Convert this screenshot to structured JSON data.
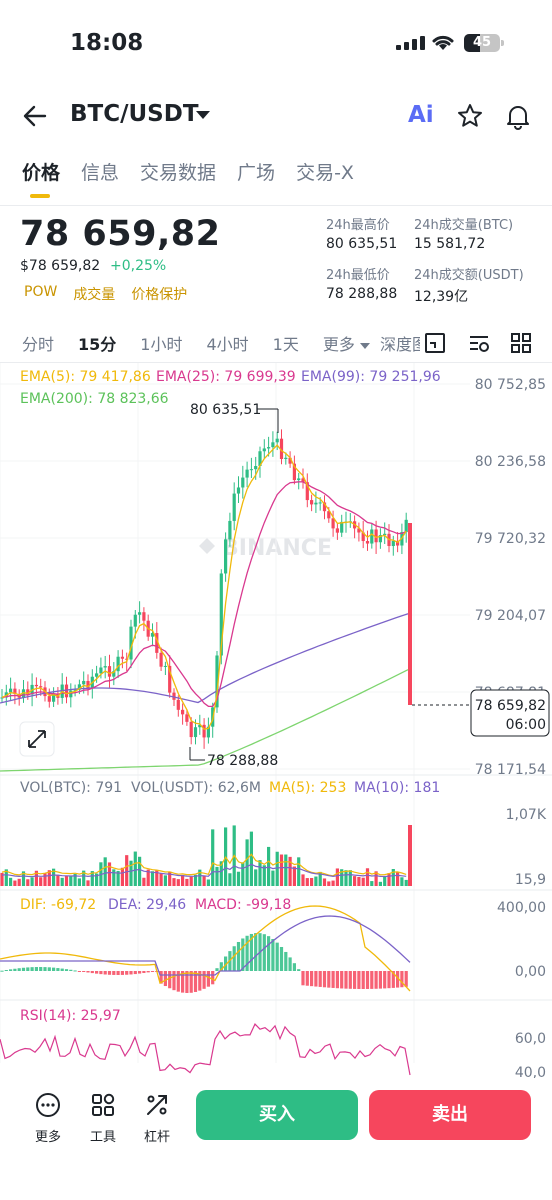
{
  "status_bar": {
    "time": "18:08",
    "battery": "45"
  },
  "header": {
    "pair": "BTC/USDT",
    "ai_label": "Ai"
  },
  "tabs": [
    {
      "label": "价格",
      "active": true
    },
    {
      "label": "信息"
    },
    {
      "label": "交易数据"
    },
    {
      "label": "广场"
    },
    {
      "label": "交易-X"
    }
  ],
  "price": {
    "last": "78 659,82",
    "usd": "$78 659,82",
    "change": "+0,25%",
    "tags": [
      "POW",
      "成交量",
      "价格保护"
    ]
  },
  "stats": {
    "high_label": "24h最高价",
    "high": "80 635,51",
    "vol_btc_label": "24h成交量(BTC)",
    "vol_btc": "15 581,72",
    "low_label": "24h最低价",
    "low": "78 288,88",
    "vol_usdt_label": "24h成交额(USDT)",
    "vol_usdt": "12,39亿"
  },
  "intervals": {
    "items": [
      "分时",
      "15分",
      "1小时",
      "4小时",
      "1天"
    ],
    "active": "15分",
    "more": "更多",
    "depth": "深度图"
  },
  "chart": {
    "ema5": "EMA(5): 79 417,86",
    "ema25": "EMA(25): 79 699,39",
    "ema99": "EMA(99): 79 251,96",
    "ema200": "EMA(200): 78 823,66",
    "y_ticks": [
      "80 752,85",
      "80 236,58",
      "79 720,32",
      "79 204,07",
      "78 687,81",
      "78 171,54"
    ],
    "high_mark": "80 635,51",
    "low_mark": "78 288,88",
    "last_price_tag": "78 659,82",
    "countdown": "06:00",
    "watermark": "BINANCE",
    "vol_btc": "VOL(BTC): 791",
    "vol_usdt": "VOL(USDT): 62,6M",
    "vol_ma5": "MA(5): 253",
    "vol_ma10": "MA(10): 181",
    "vol_ticks": [
      "1,07K",
      "15,9"
    ],
    "dif": "DIF: -69,72",
    "dea": "DEA: 29,46",
    "macd": "MACD: -99,18",
    "macd_ticks": [
      "400,00",
      "0,00"
    ],
    "rsi": "RSI(14): 25,97",
    "rsi_ticks": [
      "60,0",
      "40,0"
    ]
  },
  "colors": {
    "up": "#2ebd85",
    "down": "#f6465d",
    "ema5": "#f0b90b",
    "ema25": "#d9398f",
    "ema99": "#7b63c8",
    "ema200": "#7ed56f",
    "accent": "#f0b90b"
  },
  "bottom": {
    "more": "更多",
    "tools": "工具",
    "leverage": "杠杆",
    "buy": "买入",
    "sell": "卖出"
  }
}
